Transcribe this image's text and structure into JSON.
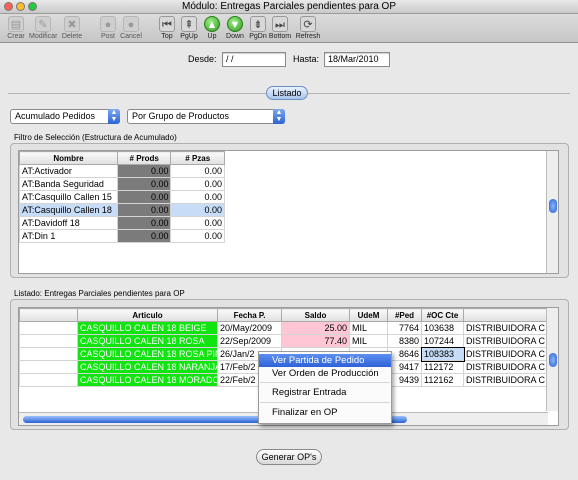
{
  "window": {
    "title": "Módulo: Entregas Parciales pendientes para OP"
  },
  "toolbar": [
    {
      "label": "Crear",
      "icon": "new-document-icon",
      "glyph": "▤",
      "style": "dis",
      "enabled": false
    },
    {
      "label": "Modificar",
      "icon": "edit-document-icon",
      "glyph": "✎",
      "style": "dis",
      "enabled": false
    },
    {
      "label": "Delete",
      "icon": "delete-icon",
      "glyph": "✖",
      "style": "dis",
      "enabled": false
    },
    {
      "label": "Post",
      "icon": "post-icon",
      "glyph": "●",
      "style": "dis",
      "enabled": false
    },
    {
      "label": "Cancel",
      "icon": "cancel-icon",
      "glyph": "●",
      "style": "dis",
      "enabled": false
    },
    {
      "label": "Top",
      "icon": "first-record-icon",
      "glyph": "⏮",
      "style": "dark",
      "enabled": true
    },
    {
      "label": "PgUp",
      "icon": "page-up-icon",
      "glyph": "⇞",
      "style": "dark",
      "enabled": true
    },
    {
      "label": "Up",
      "icon": "arrow-up-icon",
      "glyph": "▲",
      "style": "nav",
      "enabled": true
    },
    {
      "label": "Down",
      "icon": "arrow-down-icon",
      "glyph": "▼",
      "style": "nav",
      "enabled": true
    },
    {
      "label": "PgDn",
      "icon": "page-down-icon",
      "glyph": "⇟",
      "style": "dark",
      "enabled": true
    },
    {
      "label": "Bottom",
      "icon": "last-record-icon",
      "glyph": "⏭",
      "style": "dark",
      "enabled": true
    },
    {
      "label": "Refresh",
      "icon": "refresh-icon",
      "glyph": "⟳",
      "style": "dark",
      "enabled": true
    }
  ],
  "dates": {
    "from_label": "Desde:",
    "from_value": "  /   /",
    "to_label": "Hasta:",
    "to_value": "18/Mar/2010"
  },
  "listado_button": "Listado",
  "selectors": {
    "accumulate": "Acumulado Pedidos",
    "grouping": "Por Grupo de Productos"
  },
  "filter": {
    "title": "Filtro de Selección (Estructura de Acumulado)",
    "columns": [
      "Nombre",
      "# Prods",
      "# Pzas"
    ],
    "rows": [
      {
        "name": "AT:Activador",
        "prods": "0.00",
        "pzas": "0.00"
      },
      {
        "name": "AT:Banda Seguridad",
        "prods": "0.00",
        "pzas": "0.00"
      },
      {
        "name": "AT:Casquillo Callen 15",
        "prods": "0.00",
        "pzas": "0.00"
      },
      {
        "name": "AT:Casquillo Callen 18",
        "prods": "0.00",
        "pzas": "0.00"
      },
      {
        "name": "AT:Davidoff 18",
        "prods": "0.00",
        "pzas": "0.00"
      },
      {
        "name": "AT:Din 1",
        "prods": "0.00",
        "pzas": "0.00"
      }
    ]
  },
  "listado": {
    "title": "Listado: Entregas Parciales pendientes para OP",
    "columns": [
      "",
      "Articulo",
      "Fecha P.",
      "Saldo",
      "UdeM",
      "#Ped",
      "#OC Cte",
      ""
    ],
    "rows": [
      {
        "articulo": "CASQUILLO CALEN 18 BEIGE",
        "fecha": "20/May/2009",
        "saldo": "25.00",
        "udem": "MIL",
        "ped": "7764",
        "oc": "103638",
        "cliente": "DISTRIBUIDORA C"
      },
      {
        "articulo": "CASQUILLO CALEN 18 ROSA",
        "fecha": "22/Sep/2009",
        "saldo": "77.40",
        "udem": "MIL",
        "ped": "8380",
        "oc": "107244",
        "cliente": "DISTRIBUIDORA C"
      },
      {
        "articulo": "CASQUILLO CALEN 18 ROSA PINK",
        "fecha": "26/Jan/2",
        "saldo": "",
        "udem": "",
        "ped": "8646",
        "oc": "108383",
        "cliente": "DISTRIBUIDORA C"
      },
      {
        "articulo": "CASQUILLO CALEN 18 NARANJA",
        "fecha": "17/Feb/2",
        "saldo": "",
        "udem": "",
        "ped": "9417",
        "oc": "112172",
        "cliente": "DISTRIBUIDORA C"
      },
      {
        "articulo": "CASQUILLO CALEN 18 MORADO",
        "fecha": "22/Feb/2",
        "saldo": "",
        "udem": "",
        "ped": "9439",
        "oc": "112162",
        "cliente": "DISTRIBUIDORA C"
      }
    ]
  },
  "context_menu": [
    "Ver Partida de Pedido",
    "Ver Orden de Producción",
    "Registrar Entrada",
    "Finalizar en OP"
  ],
  "generate_button": "Generar OP's",
  "colors": {
    "accent": "#3a6fd8",
    "green_cell": "#11e411",
    "pink_cell": "#ffc7d5",
    "dark_cell": "#7b7b7b"
  }
}
